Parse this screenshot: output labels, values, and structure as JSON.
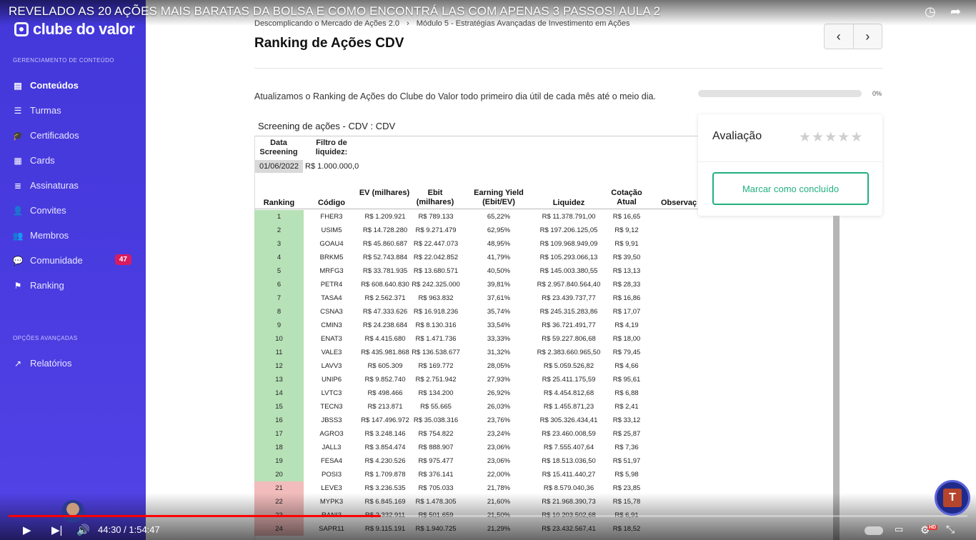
{
  "video": {
    "title": "REVELADO AS 20 AÇÕES MAIS BARATAS DA BOLSA E COMO ENCONTRÁ LAS COM APENAS 3 PASSOS! AULA 2",
    "current_time": "44:30",
    "duration": "1:54:47",
    "time_display": "44:30 / 1:54:47",
    "progress": 0.388
  },
  "sidebar": {
    "logo": "clube do valor",
    "section_content": "GERENCIAMENTO DE CONTEÚDO",
    "items": [
      {
        "label": "Conteúdos",
        "icon": "document-icon"
      },
      {
        "label": "Turmas",
        "icon": "list-icon"
      },
      {
        "label": "Certificados",
        "icon": "graduation-cap-icon"
      },
      {
        "label": "Cards",
        "icon": "grid-icon"
      },
      {
        "label": "Assinaturas",
        "icon": "stack-icon"
      },
      {
        "label": "Convites",
        "icon": "user-plus-icon"
      },
      {
        "label": "Membros",
        "icon": "users-icon"
      },
      {
        "label": "Comunidade",
        "icon": "chat-icon",
        "badge": "47"
      },
      {
        "label": "Ranking",
        "icon": "flag-icon"
      }
    ],
    "section_advanced": "OPÇÕES AVANÇADAS",
    "advanced_items": [
      {
        "label": "Relatórios",
        "icon": "trend-icon"
      }
    ]
  },
  "breadcrumb": {
    "course": "Descomplicando o Mercado de Ações 2.0",
    "module": "Módulo 5 - Estratégias Avançadas de Investimento em Ações"
  },
  "page_title": "Ranking de Ações CDV",
  "intro": "Atualizamos o Ranking de Ações do Clube do Valor todo primeiro dia útil de cada mês até o meio dia.",
  "progress": {
    "label": "0%",
    "value": 0
  },
  "rating": {
    "label": "Avaliação",
    "stars": 5,
    "value": 0,
    "button": "Marcar como concluído"
  },
  "sheet": {
    "title": "Screening de ações - CDV : CDV",
    "date_label": "Data Screening",
    "date_value": "01/06/2022",
    "filter_label": "Filtro de liquidez:",
    "filter_value": "R$ 1.000.000,0",
    "headers": [
      "Ranking",
      "Código",
      "EV (milhares)",
      "Ebit (milhares)",
      "Earning Yield (Ebit/EV)",
      "Liquidez",
      "Cotação Atual",
      "Observaç"
    ],
    "rows": [
      [
        "1",
        "FHER3",
        "R$ 1.209.921",
        "R$ 789.133",
        "65,22%",
        "R$ 11.378.791,00",
        "R$ 16,65"
      ],
      [
        "2",
        "USIM5",
        "R$ 14.728.280",
        "R$ 9.271.479",
        "62,95%",
        "R$ 197.206.125,05",
        "R$ 9,12"
      ],
      [
        "3",
        "GOAU4",
        "R$ 45.860.687",
        "R$ 22.447.073",
        "48,95%",
        "R$ 109.968.949,09",
        "R$ 9,91"
      ],
      [
        "4",
        "BRKM5",
        "R$ 52.743.884",
        "R$ 22.042.852",
        "41,79%",
        "R$ 105.293.066,13",
        "R$ 39,50"
      ],
      [
        "5",
        "MRFG3",
        "R$ 33.781.935",
        "R$ 13.680.571",
        "40,50%",
        "R$ 145.003.380,55",
        "R$ 13,13"
      ],
      [
        "6",
        "PETR4",
        "R$ 608.640.830",
        "R$ 242.325.000",
        "39,81%",
        "R$ 2.957.840.564,40",
        "R$ 28,33"
      ],
      [
        "7",
        "TASA4",
        "R$ 2.562.371",
        "R$ 963.832",
        "37,61%",
        "R$ 23.439.737,77",
        "R$ 16,86"
      ],
      [
        "8",
        "CSNA3",
        "R$ 47.333.626",
        "R$ 16.918.236",
        "35,74%",
        "R$ 245.315.283,86",
        "R$ 17,07"
      ],
      [
        "9",
        "CMIN3",
        "R$ 24.238.684",
        "R$ 8.130.316",
        "33,54%",
        "R$ 36.721.491,77",
        "R$ 4,19"
      ],
      [
        "10",
        "ENAT3",
        "R$ 4.415.680",
        "R$ 1.471.736",
        "33,33%",
        "R$ 59.227.806,68",
        "R$ 18,00"
      ],
      [
        "11",
        "VALE3",
        "R$ 435.981.868",
        "R$ 136.538.677",
        "31,32%",
        "R$ 2.383.660.965,50",
        "R$ 79,45"
      ],
      [
        "12",
        "LAVV3",
        "R$ 605.309",
        "R$ 169.772",
        "28,05%",
        "R$ 5.059.526,82",
        "R$ 4,66"
      ],
      [
        "13",
        "UNIP6",
        "R$ 9.852.740",
        "R$ 2.751.942",
        "27,93%",
        "R$ 25.411.175,59",
        "R$ 95,61"
      ],
      [
        "14",
        "LVTC3",
        "R$ 498.466",
        "R$ 134.200",
        "26,92%",
        "R$ 4.454.812,68",
        "R$ 6,88"
      ],
      [
        "15",
        "TECN3",
        "R$ 213.871",
        "R$ 55.665",
        "26,03%",
        "R$ 1.455.871,23",
        "R$ 2,41"
      ],
      [
        "16",
        "JBSS3",
        "R$ 147.496.972",
        "R$ 35.038.316",
        "23,76%",
        "R$ 305.326.434,41",
        "R$ 33,12"
      ],
      [
        "17",
        "AGRO3",
        "R$ 3.248.146",
        "R$ 754.822",
        "23,24%",
        "R$ 23.460.008,59",
        "R$ 25,87"
      ],
      [
        "18",
        "JALL3",
        "R$ 3.854.474",
        "R$ 888.907",
        "23,06%",
        "R$ 7.555.407,64",
        "R$ 7,36"
      ],
      [
        "19",
        "FESA4",
        "R$ 4.230.526",
        "R$ 975.477",
        "23,06%",
        "R$ 18.513.036,50",
        "R$ 51,97"
      ],
      [
        "20",
        "POSI3",
        "R$ 1.709.878",
        "R$ 376.141",
        "22,00%",
        "R$ 15.411.440,27",
        "R$ 5,98"
      ],
      [
        "21",
        "LEVE3",
        "R$ 3.236.535",
        "R$ 705.033",
        "21,78%",
        "R$ 8.579.040,36",
        "R$ 23,85"
      ],
      [
        "22",
        "MYPK3",
        "R$ 6.845.169",
        "R$ 1.478.305",
        "21,60%",
        "R$ 21.968.390,73",
        "R$ 15,78"
      ],
      [
        "23",
        "RANI3",
        "R$ 2.332.911",
        "R$ 501.659",
        "21,50%",
        "R$ 10.203.502,68",
        "R$ 6,91"
      ],
      [
        "24",
        "SAPR11",
        "R$ 9.115.191",
        "R$ 1.940.725",
        "21,29%",
        "R$ 23.432.567,41",
        "R$ 18,52"
      ]
    ]
  }
}
